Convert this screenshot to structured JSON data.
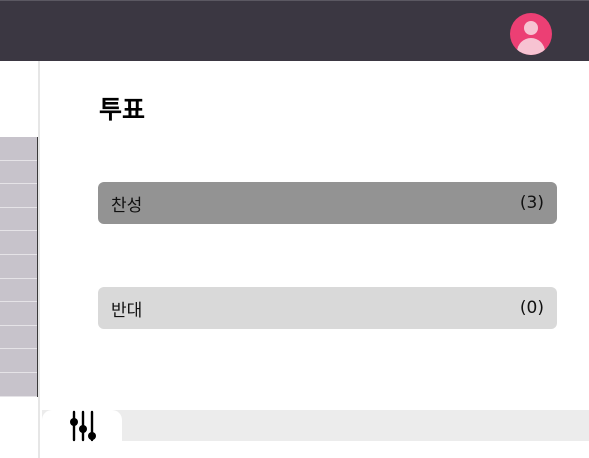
{
  "header": {
    "avatar_icon": "user-avatar-icon",
    "accent_color": "#ec3f74"
  },
  "poll": {
    "title": "투표",
    "options": [
      {
        "label": "찬성",
        "count": "(3)"
      },
      {
        "label": "반대",
        "count": "(0)"
      }
    ]
  },
  "bottom_tabs": {
    "settings_icon": "sliders-icon"
  }
}
